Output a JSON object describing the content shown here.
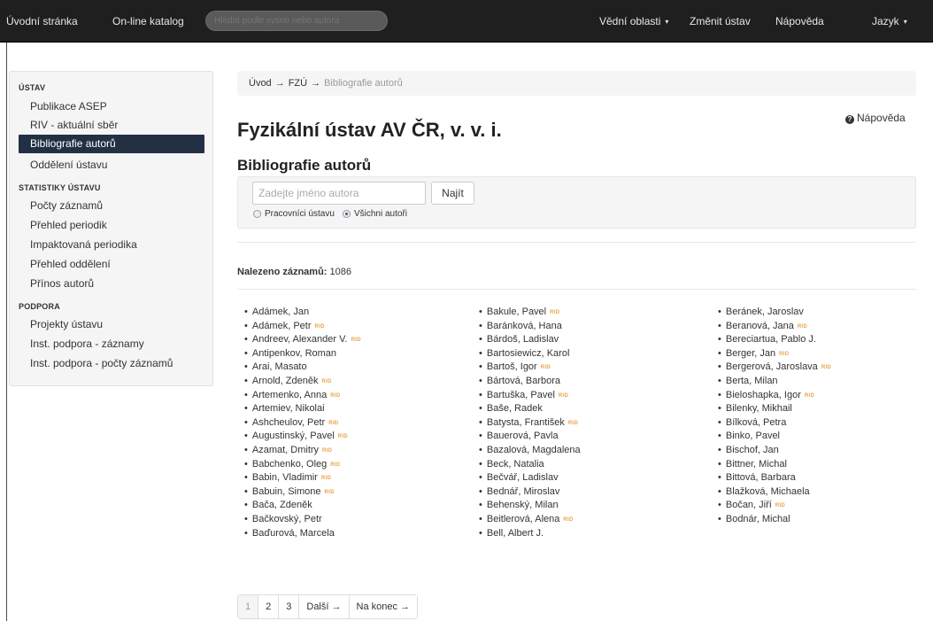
{
  "navbar": {
    "home": "Úvodní stránka",
    "catalog": "On-line katalog",
    "search_placeholder": "Hledat podle sysno nebo autora",
    "fields": "Vědní oblasti",
    "change_inst": "Změnit ústav",
    "help": "Nápověda",
    "language": "Jazyk"
  },
  "sidebar": {
    "sections": [
      {
        "heading": "ÚSTAV",
        "items": [
          "Publikace ASEP",
          "RIV - aktuální sběr",
          "Bibliografie autorů",
          "Oddělení ústavu"
        ]
      },
      {
        "heading": "STATISTIKY ÚSTAVU",
        "items": [
          "Počty záznamů",
          "Přehled periodik",
          "Impaktovaná periodika",
          "Přehled oddělení",
          "Přínos autorů"
        ]
      },
      {
        "heading": "PODPORA",
        "items": [
          "Projekty ústavu",
          "Inst. podpora - záznamy",
          "Inst. podpora - počty záznamů"
        ]
      }
    ],
    "active_item": "Bibliografie autorů"
  },
  "breadcrumb": {
    "home": "Úvod",
    "arrow": "→",
    "inst": "FZÚ",
    "current": "Bibliografie autorů"
  },
  "help_link": "Nápověda",
  "page_title": "Fyzikální ústav AV ČR, v. v. i.",
  "section_title": "Bibliografie autorů",
  "search": {
    "placeholder": "Zadejte jméno autora",
    "button": "Najít",
    "radio_staff": "Pracovníci ústavu",
    "radio_all": "Všichni autoři",
    "selected": "all"
  },
  "results": {
    "label": "Nalezeno záznamů:",
    "count": "1086"
  },
  "rid_badge": "RID",
  "authors": {
    "col1": [
      {
        "name": "Adámek, Jan",
        "rid": false
      },
      {
        "name": "Adámek, Petr",
        "rid": true
      },
      {
        "name": "Andreev, Alexander V.",
        "rid": true
      },
      {
        "name": "Antipenkov, Roman",
        "rid": false
      },
      {
        "name": "Arai, Masato",
        "rid": false
      },
      {
        "name": "Arnold, Zdeněk",
        "rid": true
      },
      {
        "name": "Artemenko, Anna",
        "rid": true
      },
      {
        "name": "Artemiev, Nikolai",
        "rid": false
      },
      {
        "name": "Ashcheulov, Petr",
        "rid": true
      },
      {
        "name": "Augustinský, Pavel",
        "rid": true
      },
      {
        "name": "Azamat, Dmitry",
        "rid": true
      },
      {
        "name": "Babchenko, Oleg",
        "rid": true
      },
      {
        "name": "Babin, Vladimir",
        "rid": true
      },
      {
        "name": "Babuin, Simone",
        "rid": true
      },
      {
        "name": "Bača, Zdeněk",
        "rid": false
      },
      {
        "name": "Bačkovský, Petr",
        "rid": false
      },
      {
        "name": "Baďurová, Marcela",
        "rid": false
      }
    ],
    "col2": [
      {
        "name": "Bakule, Pavel",
        "rid": true
      },
      {
        "name": "Baránková, Hana",
        "rid": false
      },
      {
        "name": "Bárdoš, Ladislav",
        "rid": false
      },
      {
        "name": "Bartosiewicz, Karol",
        "rid": false
      },
      {
        "name": "Bartoš, Igor",
        "rid": true
      },
      {
        "name": "Bártová, Barbora",
        "rid": false
      },
      {
        "name": "Bartuška, Pavel",
        "rid": true
      },
      {
        "name": "Baše, Radek",
        "rid": false
      },
      {
        "name": "Batysta, František",
        "rid": true
      },
      {
        "name": "Bauerová, Pavla",
        "rid": false
      },
      {
        "name": "Bazalová, Magdalena",
        "rid": false
      },
      {
        "name": "Beck, Natalia",
        "rid": false
      },
      {
        "name": "Bečvář, Ladislav",
        "rid": false
      },
      {
        "name": "Bednář, Miroslav",
        "rid": false
      },
      {
        "name": "Behenský, Milan",
        "rid": false
      },
      {
        "name": "Beitlerová, Alena",
        "rid": true
      },
      {
        "name": "Bell, Albert J.",
        "rid": false
      }
    ],
    "col3": [
      {
        "name": "Beránek, Jaroslav",
        "rid": false
      },
      {
        "name": "Beranová, Jana",
        "rid": true
      },
      {
        "name": "Bereciartua, Pablo J.",
        "rid": false
      },
      {
        "name": "Berger, Jan",
        "rid": true
      },
      {
        "name": "Bergerová, Jaroslava",
        "rid": true
      },
      {
        "name": "Berta, Milan",
        "rid": false
      },
      {
        "name": "Bieloshapka, Igor",
        "rid": true
      },
      {
        "name": "Bilenky, Mikhail",
        "rid": false
      },
      {
        "name": "Bílková, Petra",
        "rid": false
      },
      {
        "name": "Binko, Pavel",
        "rid": false
      },
      {
        "name": "Bischof, Jan",
        "rid": false
      },
      {
        "name": "Bittner, Michal",
        "rid": false
      },
      {
        "name": "Bittová, Barbara",
        "rid": false
      },
      {
        "name": "Blažková, Michaela",
        "rid": false
      },
      {
        "name": "Bočan, Jiří",
        "rid": true
      },
      {
        "name": "Bodnár, Michal",
        "rid": false
      }
    ]
  },
  "pagination": {
    "pages": [
      "1",
      "2",
      "3"
    ],
    "current": "1",
    "next": "Další →",
    "last": "Na konec →"
  }
}
